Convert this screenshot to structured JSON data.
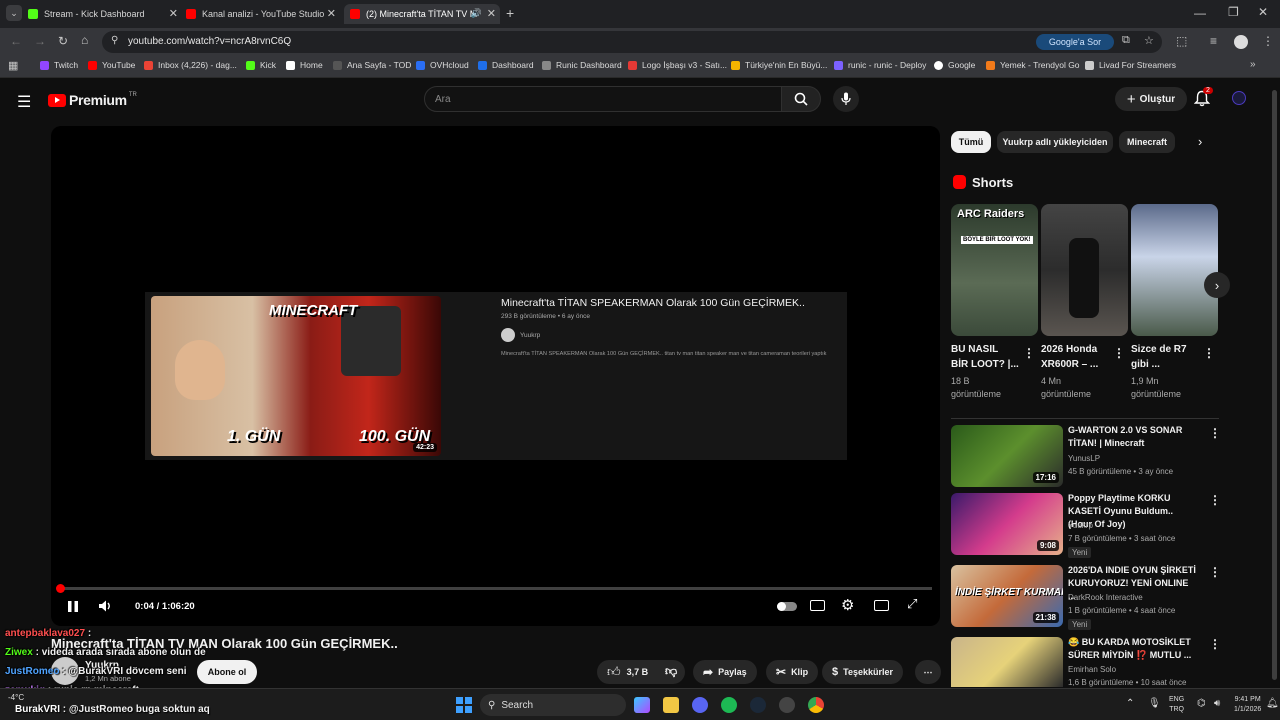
{
  "browser": {
    "tabs": [
      {
        "title": "Stream - Kick Dashboard",
        "color": "#53fc18"
      },
      {
        "title": "Kanal analizi - YouTube Studio",
        "color": "#ff0000"
      },
      {
        "title": "(2) Minecraft'ta TİTAN TV M",
        "color": "#ff0000"
      }
    ],
    "url": "youtube.com/watch?v=ncrA8rvnC6Q",
    "google_button": "Google'a Sor",
    "bookmarks": [
      "Twitch",
      "YouTube",
      "Inbox (4,226) - dag...",
      "Kick",
      "Home",
      "Ana Sayfa - TOD",
      "OVHcloud",
      "Dashboard",
      "Runic Dashboard",
      "Logo İşbaşı v3 - Satı...",
      "Türkiye'nin En Büyü...",
      "runic - runic - Deploy",
      "Google",
      "Yemek - Trendyol Go",
      "Livad For Streamers"
    ]
  },
  "youtube": {
    "logo_text": "Premium",
    "region": "TR",
    "search_placeholder": "Ara",
    "create_label": "Oluştur",
    "notif_count": "2",
    "player": {
      "time": "0:04 / 1:06:20",
      "progress": 0.001,
      "card": {
        "title": "Minecraft'ta TİTAN SPEAKERMAN Olarak 100 Gün GEÇİRMEK..",
        "meta": "293 B görüntüleme • 6 ay önce",
        "channel": "Yuukrp",
        "desc": "Minecraft'ta TİTAN SPEAKERMAN Olarak 100 Gün GEÇİRMEK.. titan tv man titan speaker man ve titan cameraman teorileri yaptık",
        "thumb_text1": "MINECRAFT",
        "thumb_text2": "1. GÜN",
        "thumb_text3": "100. GÜN",
        "thumb_dur": "42:23"
      }
    },
    "video_title": "Minecraft'ta TİTAN TV MAN Olarak 100 Gün GEÇİRMEK..",
    "channel": {
      "name": "Yuukrp",
      "subs": "1,2 Mn abone",
      "subscribe": "Abone ol"
    },
    "actions": {
      "likes": "3,7 B",
      "share": "Paylaş",
      "clip": "Klip",
      "thanks": "Teşekkürler"
    },
    "chips": [
      "Tümü",
      "Yuukrp adlı yükleyiciden",
      "Minecraft"
    ],
    "shorts_header": "Shorts",
    "shorts": [
      {
        "title1": "BU NASIL",
        "title2": "BİR LOOT? |...",
        "views": "18 B",
        "views_label": "görüntüleme",
        "badge": "ARC Raiders",
        "caption": "BÖYLE BİR LOOT YOK!"
      },
      {
        "title1": "2026 Honda",
        "title2": "XR600R – ...",
        "views": "4 Mn",
        "views_label": "görüntüleme"
      },
      {
        "title1": "Sizce de R7",
        "title2": "gibi ...",
        "views": "1,9 Mn",
        "views_label": "görüntüleme"
      }
    ],
    "recs": [
      {
        "title": "G-WARTON 2.0 VS SONAR TİTAN! | Minecraft",
        "channel": "YunusLP",
        "meta": "45 B görüntüleme • 3 ay önce",
        "dur": "17:16",
        "badge": ""
      },
      {
        "title": "Poppy Playtime KORKU KASETİ Oyunu Buldum.. (Hour Of Joy)",
        "channel": "Yuukrp",
        "meta": "7 B görüntüleme • 3 saat önce",
        "dur": "9:08",
        "badge": "Yeni"
      },
      {
        "title": "2026'DA INDIE OYUN ŞİRKETİ KURUYORUZ! YENİ ONLINE ...",
        "channel": "DarkRook Interactive",
        "meta": "1 B görüntüleme • 4 saat önce",
        "dur": "21:38",
        "badge": "Yeni",
        "thumb_text": "İNDİE ŞİRKET KURMAK"
      },
      {
        "title": "😂 BU KARDA MOTOSİKLET SÜRER MİYDİN ⁉️ MUTLU ...",
        "channel": "Emirhan Solo",
        "meta": "1,6 B görüntüleme • 10 saat önce",
        "dur": "",
        "badge": ""
      }
    ]
  },
  "chat": [
    {
      "user": "antepbaklava027",
      "sep": " :",
      "msg": "",
      "color": "#ff4f4f"
    },
    {
      "user": "Ziwex",
      "sep": " : ",
      "msg": "videda arada sırada abone olun de",
      "color": "#53fc18"
    },
    {
      "user": "JustRomeo",
      "sep": " : ",
      "msg": "@BurakVRI dövcem seni",
      "color": "#4fa3ff"
    },
    {
      "user": "zemukiq",
      "sep": " : ",
      "msg": "runic rp minecraft",
      "color": "#c77dff"
    },
    {
      "user": "BurakVRI",
      "sep": " : ",
      "msg": "@JustRomeo buga soktun aq",
      "color": "#ffffff"
    }
  ],
  "taskbar": {
    "weather": "-4°C",
    "search": "Search",
    "lang1": "ENG",
    "lang2": "TRQ",
    "time": "9:41 PM",
    "date": "1/1/2026"
  }
}
